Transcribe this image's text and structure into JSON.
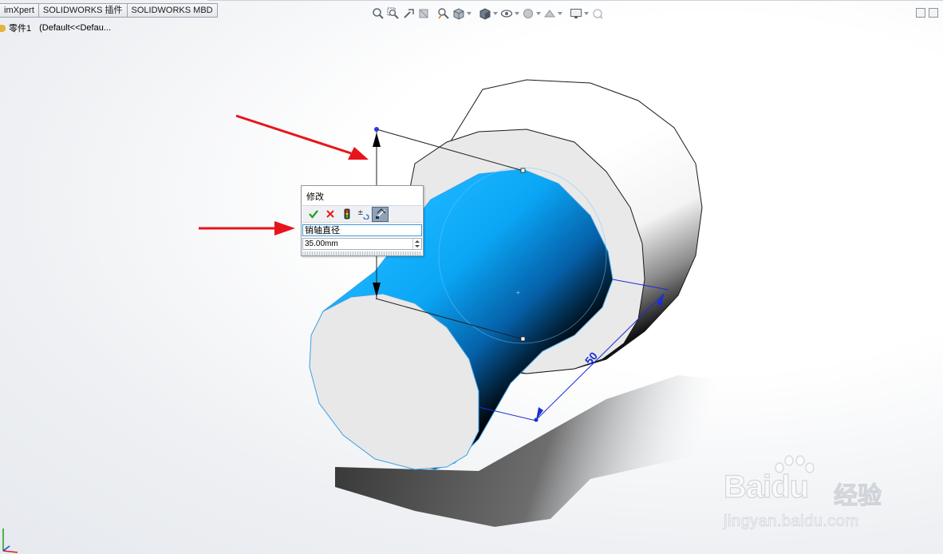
{
  "tabs": [
    {
      "label": "imXpert"
    },
    {
      "label": "SOLIDWORKS 插件"
    },
    {
      "label": "SOLIDWORKS MBD"
    }
  ],
  "tree": {
    "part_name": "零件1",
    "config": "(Default<<Defau..."
  },
  "modify_dialog": {
    "title": "修改",
    "dimension_name": "销轴直径",
    "value": "35.00mm"
  },
  "dimensions": {
    "length_label": "50"
  },
  "watermark": {
    "brand_bai": "Bai",
    "brand_du": "du",
    "brand_cn": "经验",
    "url": "jingyan.baidu.com"
  },
  "icons": [
    "zoom-to-fit-icon",
    "zoom-to-area-icon",
    "previous-view-icon",
    "section-view-icon",
    "dynamic-annotation-icon",
    "view-orientation-icon",
    "display-style-icon",
    "hide-show-items-icon",
    "edit-appearance-icon",
    "apply-scene-icon",
    "view-settings-icon",
    "rotate-view-icon"
  ],
  "colors": {
    "accent_blue": "#00a8ff",
    "dimension_blue": "#1a2fd6",
    "arrow_red": "#e8141b"
  }
}
